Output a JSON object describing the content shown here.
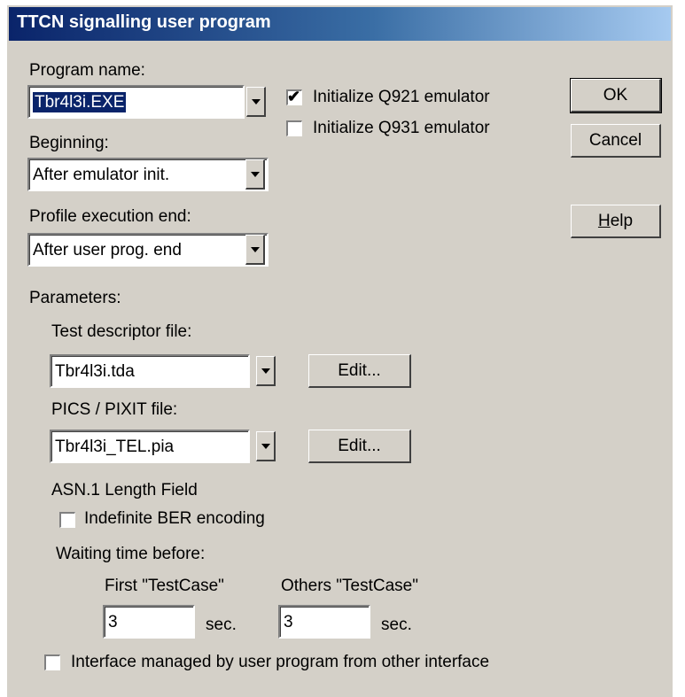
{
  "window": {
    "title": "TTCN signalling user program"
  },
  "program_name": {
    "label": "Program name:",
    "value": "Tbr4l3i.EXE"
  },
  "init_q921": {
    "label": "Initialize Q921 emulator",
    "checked": true
  },
  "init_q931": {
    "label": "Initialize Q931 emulator",
    "checked": false
  },
  "beginning": {
    "label": "Beginning:",
    "value": "After emulator init."
  },
  "profile_end": {
    "label": "Profile execution end:",
    "value": "After user prog. end"
  },
  "buttons": {
    "ok": "OK",
    "cancel": "Cancel",
    "help_accel": "H",
    "help_rest": "elp"
  },
  "parameters": {
    "label": "Parameters:",
    "test_descriptor": {
      "label": "Test descriptor file:",
      "value": "Tbr4l3i.tda",
      "edit": "Edit..."
    },
    "pics_pixit": {
      "label": "PICS / PIXIT file:",
      "value": "Tbr4l3i_TEL.pia",
      "edit": "Edit..."
    }
  },
  "asn": {
    "label": "ASN.1 Length Field",
    "indefinite_ber": {
      "label": "Indefinite BER encoding",
      "checked": false
    }
  },
  "waiting": {
    "label": "Waiting time before:",
    "first": {
      "label": "First \"TestCase\"",
      "value": "3",
      "unit": "sec."
    },
    "others": {
      "label": "Others \"TestCase\"",
      "value": "3",
      "unit": "sec."
    }
  },
  "interface_managed": {
    "label": "Interface managed by user program from other interface",
    "checked": false
  },
  "icons": {
    "dropdown": "chevron-down-icon",
    "check": "checkmark-icon"
  }
}
